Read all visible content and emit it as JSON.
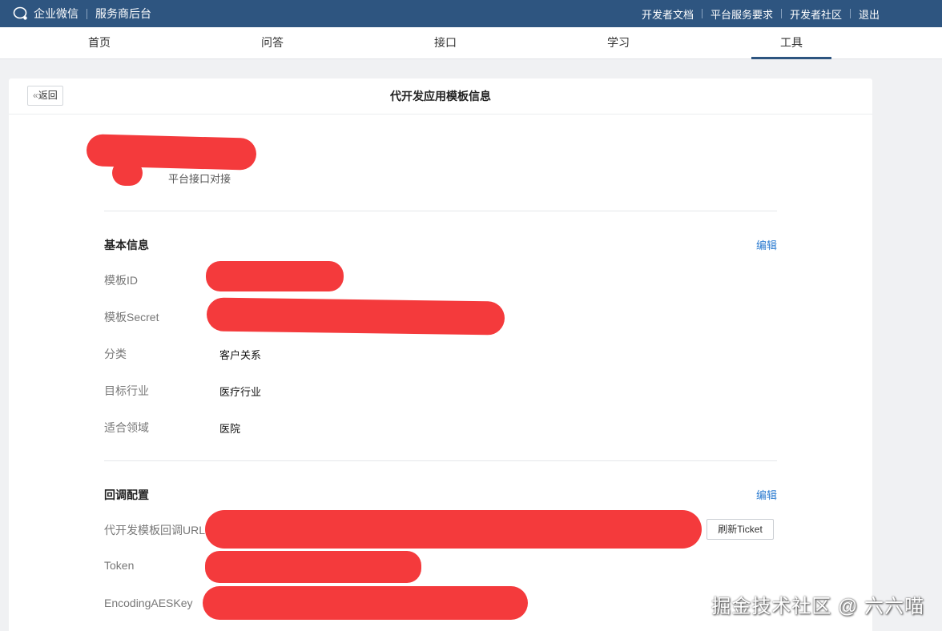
{
  "topbar": {
    "brand": "企业微信",
    "section": "服务商后台",
    "links": [
      "开发者文档",
      "平台服务要求",
      "开发者社区",
      "退出"
    ]
  },
  "nav": {
    "tabs": [
      "首页",
      "问答",
      "接口",
      "学习",
      "工具"
    ],
    "active": "工具"
  },
  "header": {
    "back_label": "返回",
    "back_glyph": "«",
    "title": "代开发应用模板信息"
  },
  "app": {
    "subtitle": "平台接口对接"
  },
  "basic": {
    "title": "基本信息",
    "edit": "编辑",
    "rows": [
      {
        "label": "模板ID",
        "value": ""
      },
      {
        "label": "模板Secret",
        "value": ""
      },
      {
        "label": "分类",
        "value": "客户关系"
      },
      {
        "label": "目标行业",
        "value": "医疗行业"
      },
      {
        "label": "适合领域",
        "value": "医院"
      }
    ]
  },
  "callback": {
    "title": "回调配置",
    "edit": "编辑",
    "rows": [
      {
        "label": "代开发模板回调URL",
        "value": ""
      },
      {
        "label": "Token",
        "value": ""
      },
      {
        "label": "EncodingAESKey",
        "value": ""
      }
    ],
    "refresh_label": "刷新Ticket"
  },
  "watermark": "掘金技术社区 @ 六六喵",
  "colors": {
    "topbar": "#2e5580",
    "link": "#2b7bd0",
    "redaction": "#f43a3c"
  }
}
